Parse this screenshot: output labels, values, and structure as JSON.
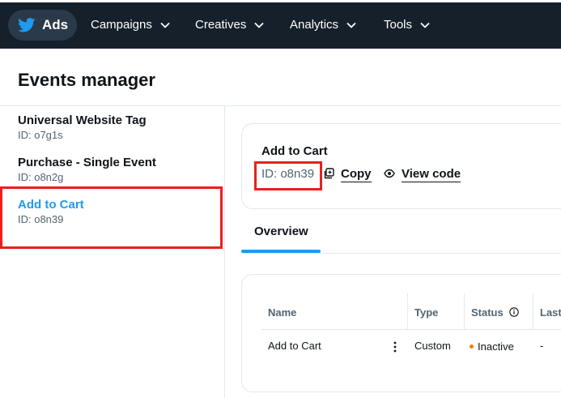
{
  "topnav": {
    "brand_label": "Ads",
    "items": [
      {
        "label": "Campaigns"
      },
      {
        "label": "Creatives"
      },
      {
        "label": "Analytics"
      },
      {
        "label": "Tools"
      }
    ]
  },
  "page": {
    "title": "Events manager"
  },
  "sidebar": {
    "items": [
      {
        "name": "Universal Website Tag",
        "id": "ID: o7g1s"
      },
      {
        "name": "Purchase - Single Event",
        "id": "ID: o8n2g"
      },
      {
        "name": "Add to Cart",
        "id": "ID: o8n39",
        "selected": true
      }
    ]
  },
  "event": {
    "title": "Add to Cart",
    "id": "ID: o8n39",
    "copy_label": "Copy",
    "view_code_label": "View code"
  },
  "tabs": [
    {
      "label": "Overview",
      "active": true
    }
  ],
  "table": {
    "columns": [
      "Name",
      "Type",
      "Status",
      "Last"
    ],
    "rows": [
      {
        "name": "Add to Cart",
        "type": "Custom",
        "status": "Inactive",
        "last": "-"
      }
    ]
  },
  "colors": {
    "nav_bg": "#15202b",
    "accent": "#1d9bf0",
    "highlight": "#e8211e",
    "status_inactive": "#f57c00"
  }
}
